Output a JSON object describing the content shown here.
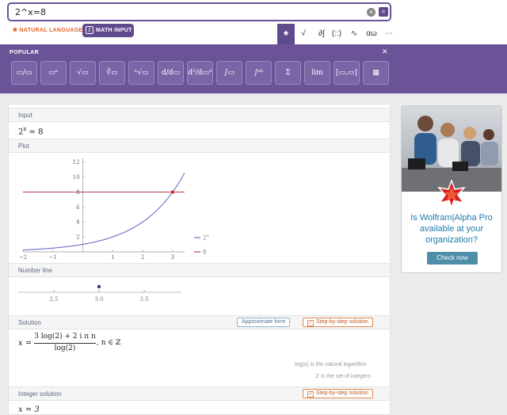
{
  "search": {
    "query": "2^x=8"
  },
  "modes": {
    "natural_language": "NATURAL LANGUAGE",
    "math_input": "MATH INPUT"
  },
  "tabs": [
    "★",
    "√",
    "∂∫",
    "(::)",
    "∿",
    "αω",
    "⋯"
  ],
  "palette": {
    "title": "POPULAR",
    "buttons": [
      "▭/▭",
      "▭ⁿ",
      "√▭",
      "∛▭",
      "ⁿ√▭",
      "d/d▭",
      "d²/d▭²",
      "∫▭",
      "∫ᵃᵇ",
      "Σ",
      "lim",
      "[▭,▭]",
      "▦"
    ]
  },
  "pods": {
    "input": {
      "title": "Input",
      "expr_base": "2",
      "expr_exp": "x",
      "expr_rest": " = 8"
    },
    "plot": {
      "title": "Plot",
      "legend": [
        {
          "label": "2",
          "sup": "x",
          "color": "#6a6ec8"
        },
        {
          "label": "8",
          "color": "#b5404a"
        }
      ]
    },
    "number_line": {
      "title": "Number line",
      "ticks": [
        "2.5",
        "3.0",
        "3.5"
      ]
    },
    "solution": {
      "title": "Solution",
      "approx_label": "Approximate form",
      "step_label": "Step-by-step solution",
      "lhs": "x =",
      "numerator": "3 log(2) + 2 i π n",
      "denominator": "log(2)",
      "cond": ",   n ∈ ℤ",
      "note1": "log(x) is the natural logarithm",
      "note2": "ℤ is the set of integers"
    },
    "integer_solution": {
      "title": "Integer solution",
      "step_label": "Step-by-step solution",
      "expr": "x = 3"
    }
  },
  "ad": {
    "text": "Is Wolfram|Alpha Pro available at your organization?",
    "button": "Check now"
  },
  "chart_data": {
    "type": "line",
    "series": [
      {
        "name": "2^x",
        "function": "2^x",
        "x_range": [
          -2,
          3.4
        ]
      },
      {
        "name": "8",
        "function": "8",
        "x_range": [
          -2,
          3.4
        ]
      }
    ],
    "intersection": {
      "x": 3,
      "y": 8
    },
    "x_ticks": [
      -2,
      -1,
      1,
      2,
      3
    ],
    "y_ticks": [
      2,
      4,
      6,
      8,
      10,
      12
    ],
    "xlim": [
      -2,
      3.4
    ],
    "ylim": [
      0,
      12.5
    ]
  }
}
